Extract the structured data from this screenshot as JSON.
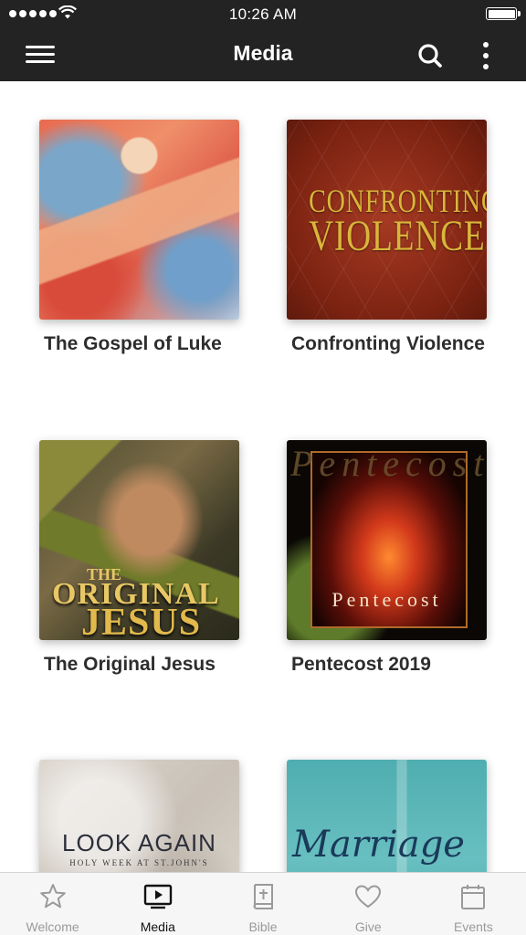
{
  "status_bar": {
    "time": "10:26 AM",
    "signal_icon": "signal-dots-icon",
    "wifi_icon": "wifi-icon",
    "battery_icon": "battery-icon"
  },
  "nav": {
    "title": "Media",
    "menu_icon": "hamburger-menu-icon",
    "search_icon": "search-icon",
    "more_icon": "more-vertical-icon"
  },
  "media_items": [
    {
      "title": "The Gospel of Luke"
    },
    {
      "title": "Confronting Violence",
      "art_line1": "CONFRONTING",
      "art_line2": "VIOLENCE"
    },
    {
      "title": "The Original Jesus",
      "art_the": "THE",
      "art_line1": "ORIGINAL",
      "art_line2": "JESUS"
    },
    {
      "title": "Pentecost 2019",
      "art_top": "Pentecost",
      "art_bottom": "Pentecost"
    },
    {
      "title": "",
      "art_line1": "LOOK AGAIN",
      "art_line2": "HOLY WEEK AT ST.JOHN'S"
    },
    {
      "title": "",
      "art_line1": "Marriage"
    }
  ],
  "tabs": [
    {
      "label": "Welcome",
      "icon": "star-icon",
      "active": false
    },
    {
      "label": "Media",
      "icon": "media-player-icon",
      "active": true
    },
    {
      "label": "Bible",
      "icon": "bible-icon",
      "active": false
    },
    {
      "label": "Give",
      "icon": "heart-icon",
      "active": false
    },
    {
      "label": "Events",
      "icon": "calendar-icon",
      "active": false
    }
  ],
  "colors": {
    "header_bg": "#232323",
    "tab_active": "#111111",
    "tab_inactive": "#9a9a9a"
  }
}
